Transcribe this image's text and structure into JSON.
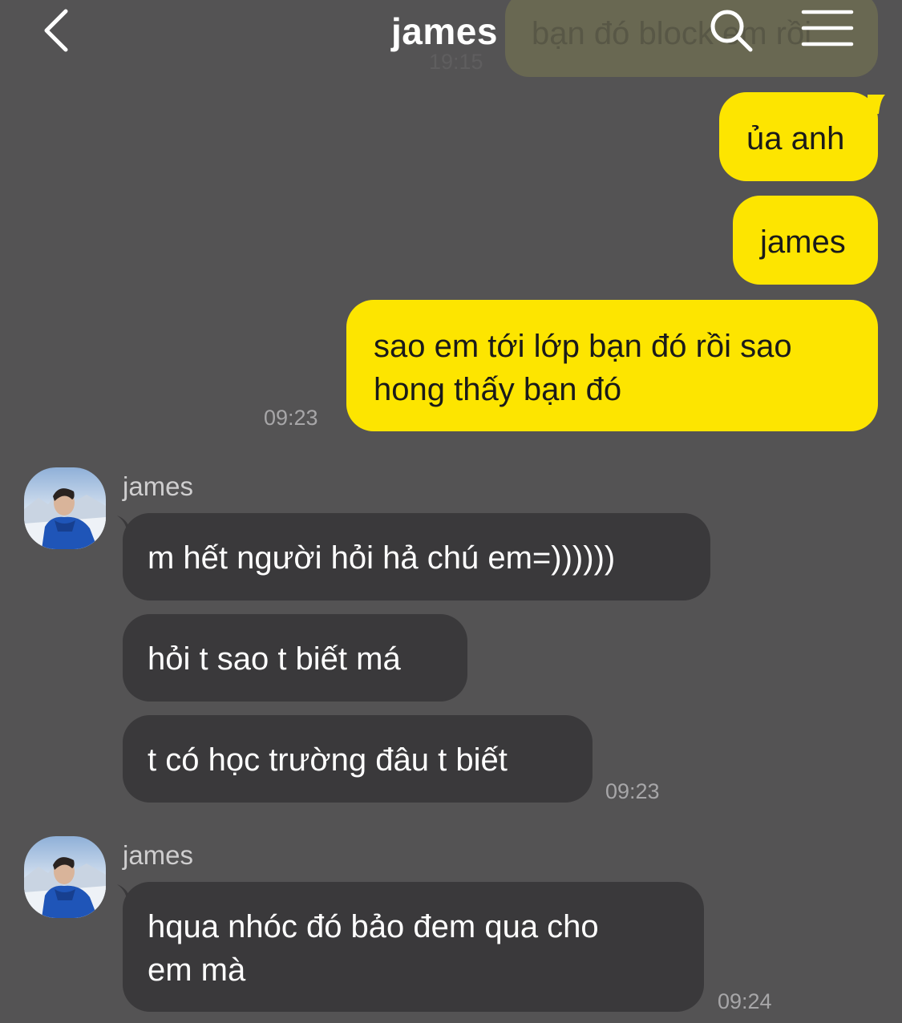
{
  "header": {
    "title": "james"
  },
  "previous_message": {
    "text": "bạn đó block em rồi",
    "time": "19:15"
  },
  "outgoing": [
    {
      "text": "ủa anh"
    },
    {
      "text": "james"
    },
    {
      "line1": "sao em tới lớp bạn đó rồi sao",
      "line2": "hong thấy bạn đó",
      "time": "09:23"
    }
  ],
  "group1": {
    "sender": "james",
    "messages": [
      {
        "text": "m hết người hỏi hả chú em=))))))"
      },
      {
        "text": "hỏi t sao t biết má"
      },
      {
        "text": "t có học trường đâu t biết"
      }
    ],
    "time": "09:23"
  },
  "group2": {
    "sender": "james",
    "line1": "hqua nhóc đó bảo đem qua cho",
    "line2": "em mà",
    "time": "09:24"
  },
  "colors": {
    "background": "#545354",
    "outgoing_bubble": "#fde500",
    "incoming_bubble": "#3a393b",
    "timestamp": "#a7a6a8"
  },
  "icons": [
    "back-icon",
    "search-icon",
    "menu-icon"
  ]
}
